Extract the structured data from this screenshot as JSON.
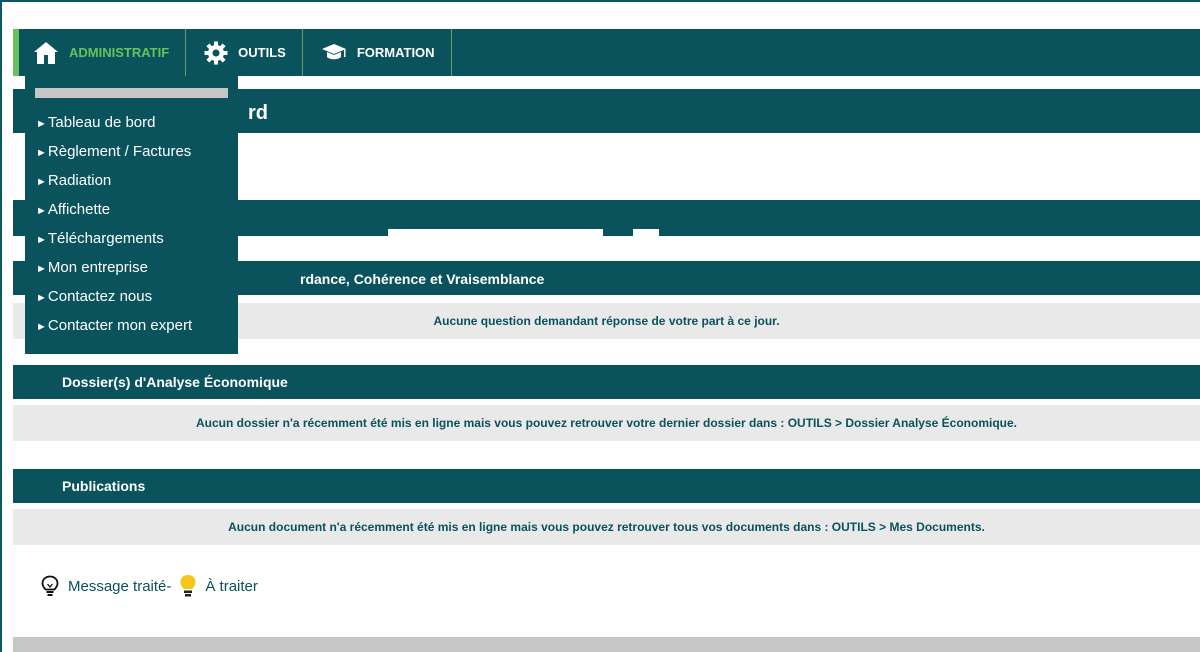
{
  "nav": {
    "items": [
      {
        "label": "ADMINISTRATIF",
        "icon": "home-icon",
        "active": true
      },
      {
        "label": "OUTILS",
        "icon": "gear-icon",
        "active": false
      },
      {
        "label": "FORMATION",
        "icon": "graduation-cap-icon",
        "active": false
      }
    ]
  },
  "dropdown": {
    "items": [
      {
        "label": "Tableau de bord"
      },
      {
        "label": "Règlement / Factures"
      },
      {
        "label": "Radiation"
      },
      {
        "label": "Affichette"
      },
      {
        "label": "Téléchargements"
      },
      {
        "label": "Mon entreprise"
      },
      {
        "label": "Contactez nous"
      },
      {
        "label": "Contacter mon expert"
      }
    ],
    "arrow": "►"
  },
  "page": {
    "title_partial": "rd"
  },
  "sections": {
    "concordance": {
      "title_partial": "rdance, Cohérence et Vraisemblance",
      "message": "Aucune question demandant réponse de votre part à ce jour."
    },
    "analyse": {
      "title": "Dossier(s) d'Analyse Économique",
      "message": "Aucun dossier n'a récemment été mis en ligne mais vous pouvez retrouver votre dernier dossier dans : OUTILS > Dossier Analyse Économique."
    },
    "publications": {
      "title": "Publications",
      "message": "Aucun document n'a récemment été mis en ligne mais vous pouvez retrouver tous vos documents dans : OUTILS > Mes Documents."
    }
  },
  "legend": {
    "done_label": "Message traité-",
    "todo_label": "À traiter"
  },
  "colors": {
    "primary": "#0a525c",
    "accent": "#69c05f",
    "row_bg": "#e9e9e9",
    "bulb_yellow": "#f5c518"
  }
}
